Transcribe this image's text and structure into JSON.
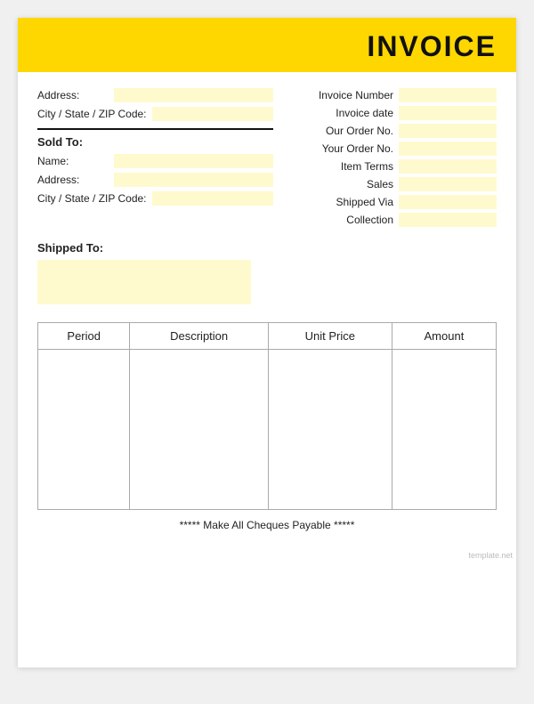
{
  "header": {
    "title": "INVOICE"
  },
  "left_top": {
    "address_label": "Address:",
    "city_label": "City / State / ZIP Code:"
  },
  "sold_to": {
    "label": "Sold To:"
  },
  "sold_to_fields": {
    "name_label": "Name:",
    "address_label": "Address:",
    "city_label": "City / State / ZIP Code:"
  },
  "right_fields": [
    {
      "label": "Invoice Number"
    },
    {
      "label": "Invoice date"
    },
    {
      "label": "Our Order No."
    },
    {
      "label": "Your Order No."
    },
    {
      "label": "Item Terms"
    },
    {
      "label": "Sales"
    },
    {
      "label": "Shipped Via"
    },
    {
      "label": "Collection"
    }
  ],
  "shipped_to": {
    "label": "Shipped To:"
  },
  "table": {
    "columns": [
      "Period",
      "Description",
      "Unit Price",
      "Amount"
    ]
  },
  "footer": {
    "text": "***** Make All Cheques Payable *****"
  },
  "watermark": "template.net"
}
